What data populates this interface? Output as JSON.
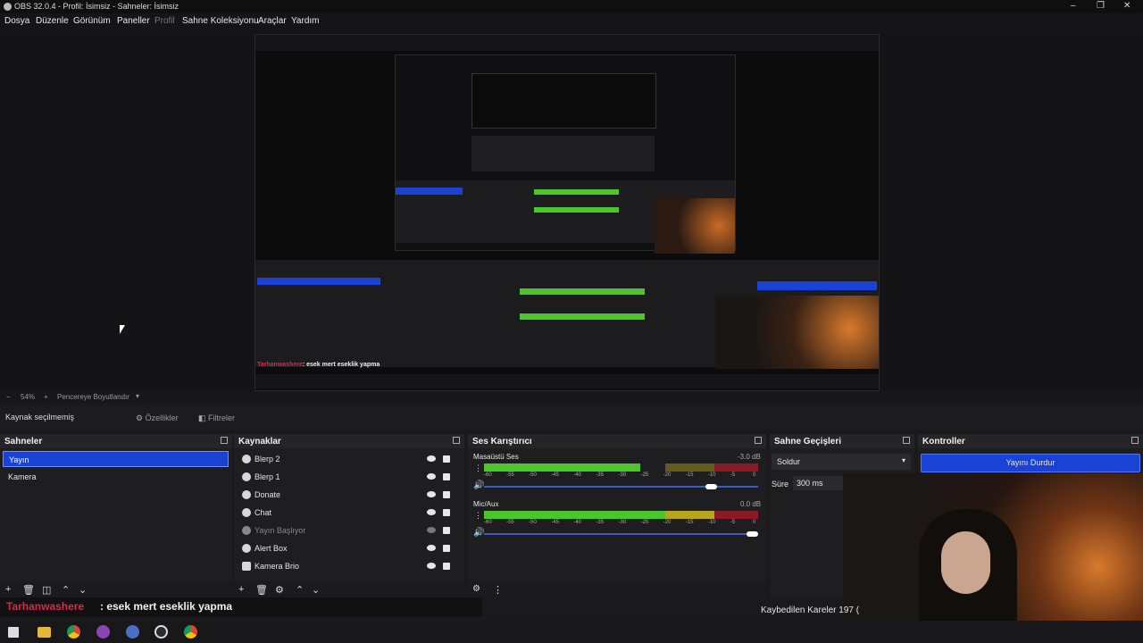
{
  "window": {
    "title": "OBS 32.0.4 - Profil: İsimsiz - Sahneler: İsimsiz",
    "controls": [
      "–",
      "❐",
      "✕"
    ]
  },
  "menu": [
    "Dosya",
    "Düzenle",
    "Görünüm",
    "Paneller",
    "Profil",
    "Sahne Koleksiyonu",
    "Araçlar",
    "Yardım"
  ],
  "preview": {
    "zoom": "54%",
    "fit_label": "Pencereye Boyutlandır",
    "nested_chat_user": "Tarhanwashere",
    "nested_chat_msg": ": esek mert eseklik yapma"
  },
  "source_toolbar": {
    "no_source": "Kaynak seçilmemiş",
    "properties": "Özellikler",
    "filters": "Filtreler"
  },
  "scenes": {
    "title": "Sahneler",
    "items": [
      "Yayın",
      "Kamera"
    ]
  },
  "sources": {
    "title": "Kaynaklar",
    "items": [
      "Blerp 2",
      "Blerp 1",
      "Donate",
      "Chat",
      "Yayın Başlıyor",
      "Alert Box",
      "Kamera Brio"
    ]
  },
  "mixer": {
    "title": "Ses Karıştırıcı",
    "channels": [
      {
        "name": "Masaüstü Ses",
        "db": "-3.0 dB",
        "level": 0.57,
        "volume": 0.84
      },
      {
        "name": "Mic/Aux",
        "db": "0.0 dB",
        "level": 0.84,
        "volume": 0.99
      }
    ],
    "scale": [
      "-60",
      "-55",
      "-50",
      "-45",
      "-40",
      "-35",
      "-30",
      "-25",
      "-20",
      "-15",
      "-10",
      "-5",
      "0"
    ]
  },
  "transitions": {
    "title": "Sahne Geçişleri",
    "selected": "Soldur",
    "duration_label": "Süre",
    "duration_value": "300 ms"
  },
  "controls": {
    "title": "Kontroller",
    "stop_stream": "Yayını Durdur"
  },
  "status": {
    "dropped": "Kaybedilen Kareler 197 ("
  },
  "chat": {
    "user": "Tarhanwashere",
    "message": ": esek mert eseklik yapma"
  },
  "colors": {
    "accent": "#1a42d4",
    "meter_green": "#4ac72d",
    "meter_yellow": "#b5a719",
    "meter_red": "#8c1a25",
    "chat_user": "#d42a4a"
  },
  "taskbar": [
    "windows-start-icon",
    "file-explorer-icon",
    "chrome-icon",
    "app-icon-1",
    "app-icon-2",
    "obs-icon",
    "app-icon-3"
  ]
}
